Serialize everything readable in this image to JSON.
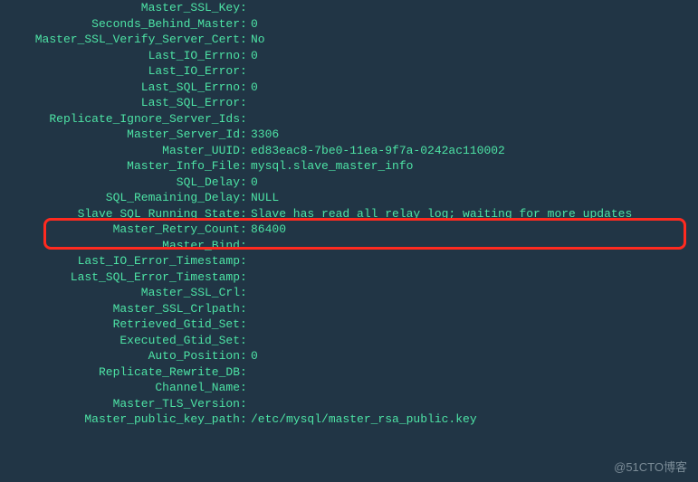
{
  "rows": [
    {
      "key": "Master_SSL_Key",
      "value": ""
    },
    {
      "key": "Seconds_Behind_Master",
      "value": "0"
    },
    {
      "key": "Master_SSL_Verify_Server_Cert",
      "value": "No"
    },
    {
      "key": "Last_IO_Errno",
      "value": "0"
    },
    {
      "key": "Last_IO_Error",
      "value": ""
    },
    {
      "key": "Last_SQL_Errno",
      "value": "0"
    },
    {
      "key": "Last_SQL_Error",
      "value": ""
    },
    {
      "key": "Replicate_Ignore_Server_Ids",
      "value": ""
    },
    {
      "key": "Master_Server_Id",
      "value": "3306"
    },
    {
      "key": "Master_UUID",
      "value": "ed83eac8-7be0-11ea-9f7a-0242ac110002"
    },
    {
      "key": "Master_Info_File",
      "value": "mysql.slave_master_info"
    },
    {
      "key": "SQL_Delay",
      "value": "0"
    },
    {
      "key": "SQL_Remaining_Delay",
      "value": "NULL"
    },
    {
      "key": "Slave_SQL_Running_State",
      "value": "Slave has read all relay log; waiting for more updates"
    },
    {
      "key": "Master_Retry_Count",
      "value": "86400"
    },
    {
      "key": "Master_Bind",
      "value": ""
    },
    {
      "key": "Last_IO_Error_Timestamp",
      "value": ""
    },
    {
      "key": "Last_SQL_Error_Timestamp",
      "value": ""
    },
    {
      "key": "Master_SSL_Crl",
      "value": ""
    },
    {
      "key": "Master_SSL_Crlpath",
      "value": ""
    },
    {
      "key": "Retrieved_Gtid_Set",
      "value": ""
    },
    {
      "key": "Executed_Gtid_Set",
      "value": ""
    },
    {
      "key": "Auto_Position",
      "value": "0"
    },
    {
      "key": "Replicate_Rewrite_DB",
      "value": ""
    },
    {
      "key": "Channel_Name",
      "value": ""
    },
    {
      "key": "Master_TLS_Version",
      "value": ""
    },
    {
      "key": "Master_public_key_path",
      "value": "/etc/mysql/master_rsa_public.key"
    }
  ],
  "watermark": "@51CTO博客"
}
